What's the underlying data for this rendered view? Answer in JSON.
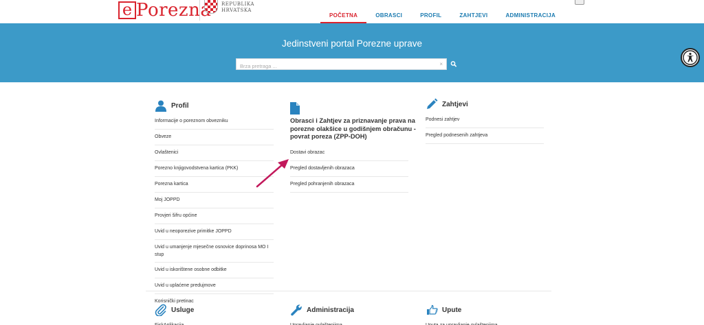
{
  "header": {
    "logo_e": "e",
    "logo_text": "Porezna",
    "republika": "REPUBLIKA",
    "hrvatska": "HRVATSKA",
    "nav": [
      {
        "label": "POČETNA",
        "active": true
      },
      {
        "label": "OBRASCI",
        "active": false
      },
      {
        "label": "PROFIL",
        "active": false
      },
      {
        "label": "ZAHTJEVI",
        "active": false
      },
      {
        "label": "ADMINISTRACIJA",
        "active": false
      }
    ]
  },
  "banner": {
    "title": "Jedinstveni portal Porezne uprave",
    "search_placeholder": "Brza pretraga ...",
    "search_clear": "×"
  },
  "profil": {
    "title": "Profil",
    "items": [
      "Informacije o poreznom obvezniku",
      "Obveze",
      "Ovlaštenici",
      "Porezno knjigovodstvena kartica (PKK)",
      "Porezna kartica",
      "Moj JOPPD",
      "Provjeri šifru općine",
      "Uvid u neoporezive primitke JOPPD",
      "Uvid u umanjenje mjesečne osnovice doprinosa MO I stup",
      "Uvid u iskorištene osobne odbitke",
      "Uvid u uplaćene predujmove",
      "Korisnički pretinac"
    ]
  },
  "obrasci": {
    "title": "Obrasci i Zahtjev za priznavanje prava na porezne olakšice u godišnjem obračunu - povrat poreza (ZPP-DOH)",
    "items": [
      "Dostavi obrazac",
      "Pregled dostavljenih obrazaca",
      "Pregled pohranjenih obrazaca"
    ]
  },
  "zahtjevi": {
    "title": "Zahtjevi",
    "items": [
      "Podnesi zahtjev",
      "Pregled podnesenih zahtjeva"
    ]
  },
  "usluge": {
    "title": "Usluge",
    "items": [
      "FiskAplikacija"
    ]
  },
  "administracija": {
    "title": "Administracija",
    "items": [
      "Upravljanje ovlaštenjima"
    ]
  },
  "upute": {
    "title": "Upute",
    "items": [
      "Uputa za upravljanje ovlaštenjima"
    ]
  },
  "colors": {
    "brand_red": "#d9232d",
    "banner_blue": "#3c9ac8",
    "link_blue": "#1a7ab0",
    "icon_blue": "#2a83bf",
    "annotation_arrow": "#c2185b"
  },
  "icons": {
    "profil": "user-icon",
    "obrasci": "document-icon",
    "zahtjevi": "pencil-icon",
    "usluge": "paperclip-icon",
    "administracija": "wrench-icon",
    "upute": "pointing-hand-icon",
    "search": "search-icon",
    "accessibility": "accessibility-icon"
  }
}
